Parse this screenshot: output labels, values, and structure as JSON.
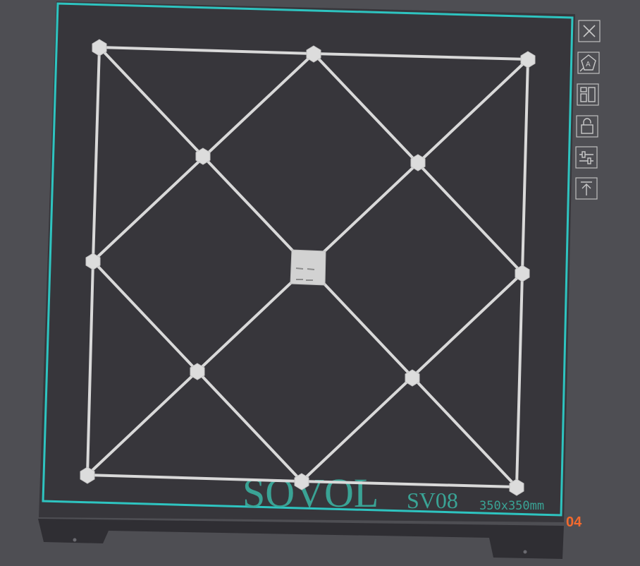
{
  "plate": {
    "brand": "SOVOL",
    "model": "SV08",
    "size_label": "350x350mm",
    "plate_number": "04"
  },
  "colors": {
    "background": "#4e4e53",
    "plate": "#37363b",
    "plate_border": "#2ec4c0",
    "model_lines": "#d9d9d9",
    "brand_text": "#3aa395",
    "plate_number": "#f26a2e",
    "icon": "#c9c9c9"
  },
  "toolbar": {
    "buttons": [
      {
        "name": "close-icon",
        "title": "Remove"
      },
      {
        "name": "auto-orient-icon",
        "title": "Auto orient"
      },
      {
        "name": "arrange-icon",
        "title": "Arrange"
      },
      {
        "name": "lock-icon",
        "title": "Lock"
      },
      {
        "name": "settings-sliders-icon",
        "title": "Settings"
      },
      {
        "name": "move-to-top-icon",
        "title": "Move to top"
      }
    ]
  }
}
